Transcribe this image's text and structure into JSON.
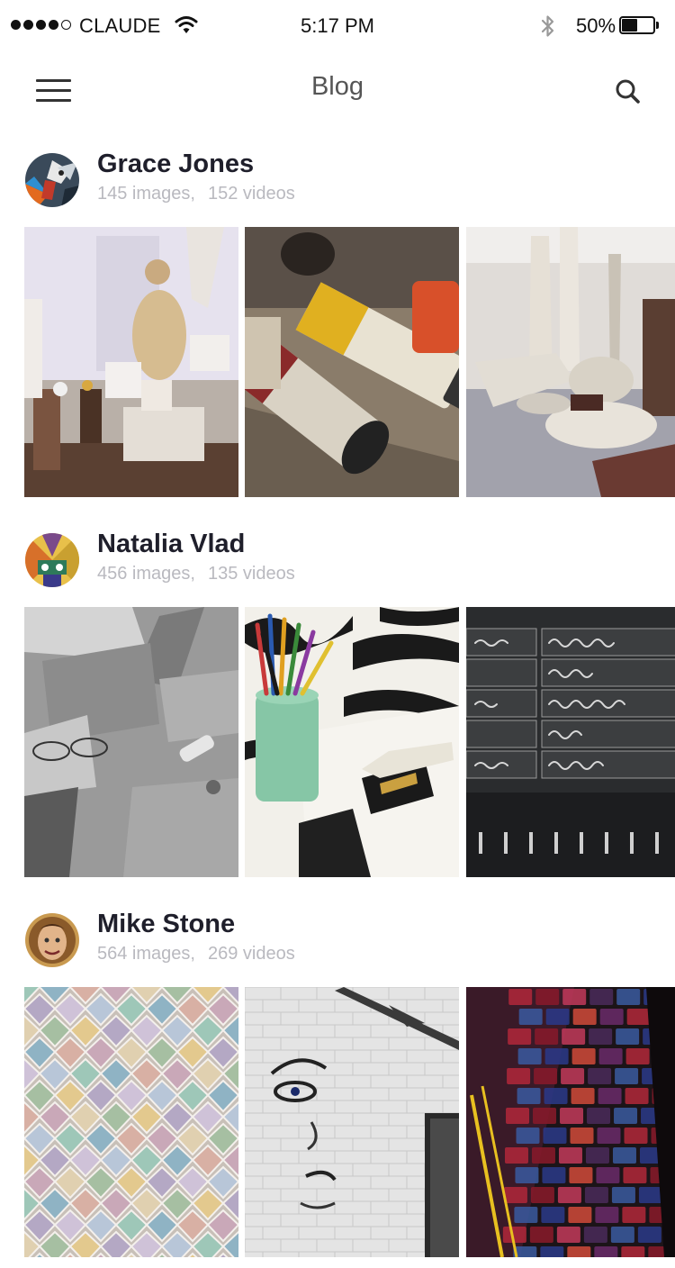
{
  "status_bar": {
    "carrier": "CLAUDE",
    "time": "5:17 PM",
    "battery_percent": "50%",
    "battery_level": 0.5,
    "icons": [
      "signal-dots-icon",
      "wifi-icon",
      "bluetooth-icon",
      "battery-icon"
    ]
  },
  "nav": {
    "title": "Blog",
    "menu_icon": "hamburger-menu-icon",
    "search_icon": "search-icon"
  },
  "posts": [
    {
      "name": "Grace Jones",
      "images_count": "145 images,",
      "videos_count": "152 videos",
      "photos": [
        "sculpture-studio-photo",
        "paint-tubes-photo",
        "stone-sculptures-gallery-photo"
      ]
    },
    {
      "name": "Natalia Vlad",
      "images_count": "456 images,",
      "videos_count": "135 videos",
      "photos": [
        "paper-and-glasses-photo",
        "colored-pencils-photo",
        "chalkboard-menu-photo"
      ]
    },
    {
      "name": "Mike Stone",
      "images_count": "564 images,",
      "videos_count": "269 videos",
      "photos": [
        "pastel-tiles-photo",
        "white-brick-graffiti-photo",
        "colorful-brick-wall-photo"
      ]
    }
  ],
  "colors": {
    "text_primary": "#1f1f2b",
    "text_secondary": "#b9b9bf",
    "title": "#555555",
    "background": "#ffffff"
  }
}
